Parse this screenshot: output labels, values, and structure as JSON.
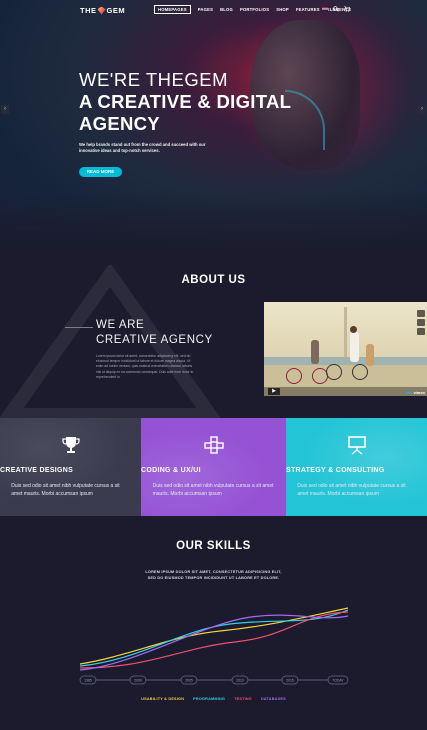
{
  "nav": {
    "logo_left": "THE",
    "logo_right": "GEM",
    "items": [
      {
        "label": "HOMEPAGES",
        "active": true
      },
      {
        "label": "PAGES"
      },
      {
        "label": "BLOG"
      },
      {
        "label": "PORTFOLIOS"
      },
      {
        "label": "SHOP"
      },
      {
        "label": "FEATURES"
      },
      {
        "label": "ELEMENTS"
      }
    ]
  },
  "hero": {
    "line1": "WE'RE THEGEM",
    "line2": "A CREATIVE & DIGITAL",
    "line3": "AGENCY",
    "subtitle": "We help brands stand out from the crowd and succeed with our innovative ideas and top-notch services.",
    "button": "READ MORE",
    "prev_arrow": "‹",
    "next_arrow": "›"
  },
  "about": {
    "title": "ABOUT US",
    "heading1": "WE ARE",
    "heading2": "CREATIVE AGENCY",
    "text": "Lorem ipsum dolor sit amet, consectetur adipisicing elit, sed do eiusmod tempor incididunt ut labore et dolore magna aliqua. Ut enim ad minim veniam, quis nostrud exercitation ullamco laboris nisi ut aliquip ex ea commodo consequat. Duis aute irure dolor in reprehenderit in",
    "video_brand": "vimeo",
    "video_hd": "HD"
  },
  "services": [
    {
      "title": "CREATIVE DESIGNS",
      "text": "Duis sed odio sit amet nibh vulputate cursus a sit amet mauris. Morbi accumsan ipsum",
      "color": "#3b3b4f",
      "icon": "trophy-icon"
    },
    {
      "title": "CODING & UX/UI",
      "text": "Duis sed odio sit amet nibh vulputate cursus a sit amet mauris. Morbi accumsan ipsum",
      "color": "#9452d4",
      "icon": "code-blocks-icon"
    },
    {
      "title": "STRATEGY & CONSULTING",
      "text": "Duis sed odio sit amet nibh vulputate cursus a sit amet mauris. Morbi accumsan ipsum",
      "color": "#22c4d6",
      "icon": "presentation-icon"
    }
  ],
  "skills": {
    "title": "OUR SKILLS",
    "subtitle1": "LOREM IPSUM DOLOR SIT AMET, CONSECTETUR ADIPISICING ELIT,",
    "subtitle2": "SED DO EIUSMOD TEMPOR INCIDIDUNT UT LABORE ET DOLORE.",
    "years": [
      "1985",
      "2000",
      "2005",
      "2010",
      "2015",
      "TODAY"
    ],
    "legend": [
      {
        "label": "USABILITY & DESIGN",
        "color": "#f5d33a"
      },
      {
        "label": "PROGRAMMING",
        "color": "#2fd4e6"
      },
      {
        "label": "TESTING",
        "color": "#f0506e"
      },
      {
        "label": "DATABASES",
        "color": "#a36af2"
      }
    ]
  }
}
